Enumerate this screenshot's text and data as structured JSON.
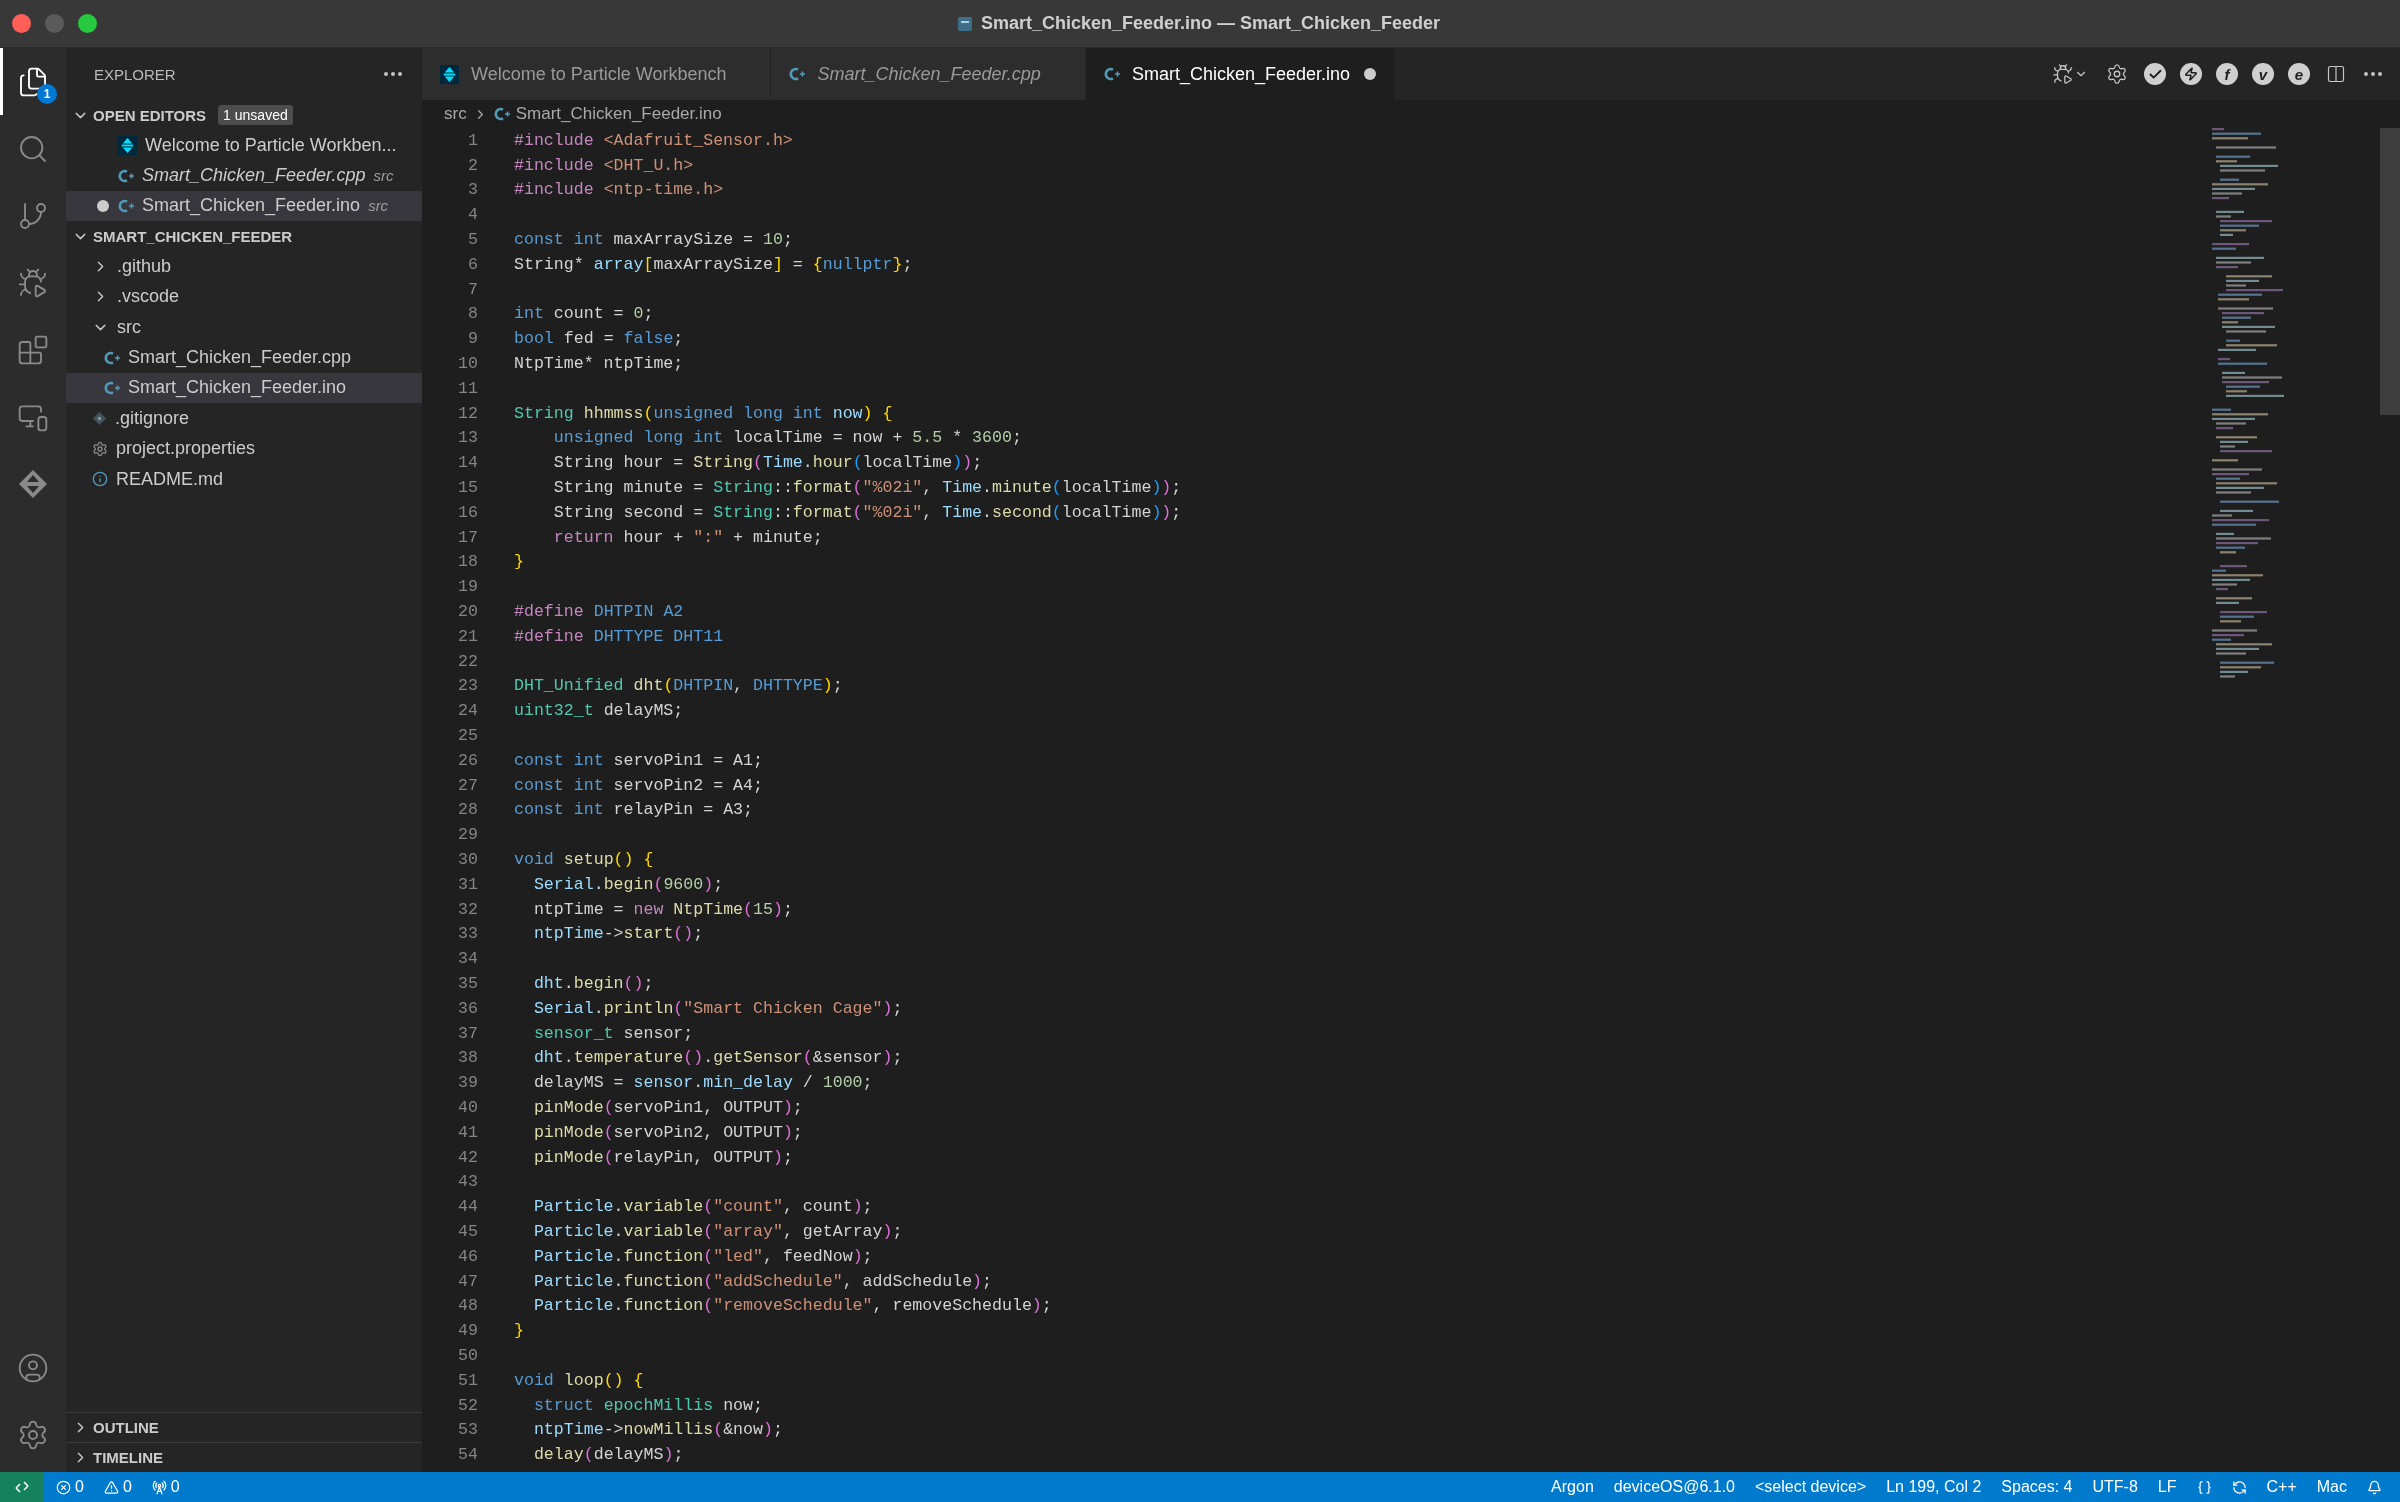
{
  "window": {
    "title": "Smart_Chicken_Feeder.ino — Smart_Chicken_Feeder"
  },
  "activity_bar": {
    "top": [
      {
        "kind": "files",
        "selected": true,
        "badge": "1"
      },
      {
        "kind": "search",
        "selected": false
      },
      {
        "kind": "source-control",
        "selected": false
      },
      {
        "kind": "run-debug",
        "selected": false
      },
      {
        "kind": "extensions",
        "selected": false
      },
      {
        "kind": "remote",
        "selected": false
      },
      {
        "kind": "particle",
        "selected": false
      }
    ],
    "bottom": [
      {
        "kind": "account"
      },
      {
        "kind": "settings"
      }
    ]
  },
  "sidebar": {
    "title": "EXPLORER",
    "open_editors": {
      "label": "OPEN EDITORS",
      "badge": "1 unsaved",
      "expanded": true,
      "items": [
        {
          "name": "Welcome to Particle Workben...",
          "kind": "particle",
          "preview": false,
          "dirty": false,
          "selected": false
        },
        {
          "name": "Smart_Chicken_Feeder.cpp",
          "description": "src",
          "kind": "cpp",
          "preview": true,
          "dirty": false,
          "selected": false
        },
        {
          "name": "Smart_Chicken_Feeder.ino",
          "description": "src",
          "kind": "cpp",
          "preview": false,
          "dirty": true,
          "selected": true
        }
      ]
    },
    "project": {
      "label": "SMART_CHICKEN_FEEDER",
      "expanded": true,
      "tree": [
        {
          "name": ".github",
          "kind": "folder",
          "expanded": false,
          "selected": false
        },
        {
          "name": ".vscode",
          "kind": "folder",
          "expanded": false,
          "selected": false
        },
        {
          "name": "src",
          "kind": "folder",
          "expanded": true,
          "selected": false,
          "children": [
            {
              "name": "Smart_Chicken_Feeder.cpp",
              "kind": "cpp",
              "selected": false
            },
            {
              "name": "Smart_Chicken_Feeder.ino",
              "kind": "cpp",
              "selected": true
            }
          ]
        },
        {
          "name": ".gitignore",
          "kind": "git",
          "selected": false
        },
        {
          "name": "project.properties",
          "kind": "gear",
          "selected": false
        },
        {
          "name": "README.md",
          "kind": "info",
          "selected": false
        }
      ]
    },
    "bottom_sections": [
      {
        "label": "OUTLINE",
        "expanded": false
      },
      {
        "label": "TIMELINE",
        "expanded": false
      }
    ]
  },
  "tabs": [
    {
      "label": "Welcome to Particle Workbench",
      "kind": "particle",
      "preview": false,
      "dirty": false,
      "selected": false
    },
    {
      "label": "Smart_Chicken_Feeder.cpp",
      "kind": "cpp",
      "preview": true,
      "dirty": false,
      "selected": false
    },
    {
      "label": "Smart_Chicken_Feeder.ino",
      "kind": "cpp",
      "preview": false,
      "dirty": true,
      "selected": true
    }
  ],
  "editor_actions": [
    {
      "kind": "run-debug"
    },
    {
      "kind": "gear"
    },
    {
      "kind": "check"
    },
    {
      "kind": "bolt"
    },
    {
      "kind": "letter",
      "text": "f"
    },
    {
      "kind": "letter",
      "text": "v"
    },
    {
      "kind": "letter",
      "text": "e"
    },
    {
      "kind": "split"
    },
    {
      "kind": "more"
    }
  ],
  "breadcrumb": [
    {
      "text": "src",
      "kind": "folder"
    },
    {
      "text": "Smart_Chicken_Feeder.ino",
      "kind": "cpp"
    }
  ],
  "code": {
    "lines": [
      {
        "n": "1",
        "tokens": [
          {
            "kind": "pp",
            "text": "#include "
          },
          {
            "kind": "str",
            "text": "<Adafruit_Sensor.h>"
          }
        ]
      },
      {
        "n": "2",
        "tokens": [
          {
            "kind": "pp",
            "text": "#include "
          },
          {
            "kind": "str",
            "text": "<DHT_U.h>"
          }
        ]
      },
      {
        "n": "3",
        "tokens": [
          {
            "kind": "pp",
            "text": "#include "
          },
          {
            "kind": "str",
            "text": "<ntp-time.h>"
          }
        ]
      },
      {
        "n": "4"
      },
      {
        "n": "5",
        "tokens": [
          {
            "kind": "kw",
            "text": "const int "
          },
          {
            "kind": "pl",
            "text": "maxArraySize = "
          },
          {
            "kind": "num",
            "text": "10"
          },
          {
            "kind": "pl",
            "text": ";"
          }
        ]
      },
      {
        "n": "6",
        "tokens": [
          {
            "kind": "pl",
            "text": "String* "
          },
          {
            "kind": "var",
            "text": "array"
          },
          {
            "kind": "br1",
            "text": "["
          },
          {
            "kind": "pl",
            "text": "maxArraySize"
          },
          {
            "kind": "br1",
            "text": "]"
          },
          {
            "kind": "pl",
            "text": " = "
          },
          {
            "kind": "br1",
            "text": "{"
          },
          {
            "kind": "kw",
            "text": "nullptr"
          },
          {
            "kind": "br1",
            "text": "}"
          },
          {
            "kind": "pl",
            "text": ";"
          }
        ]
      },
      {
        "n": "7"
      },
      {
        "n": "8",
        "tokens": [
          {
            "kind": "kw",
            "text": "int "
          },
          {
            "kind": "pl",
            "text": "count = "
          },
          {
            "kind": "num",
            "text": "0"
          },
          {
            "kind": "pl",
            "text": ";"
          }
        ]
      },
      {
        "n": "9",
        "tokens": [
          {
            "kind": "kw",
            "text": "bool "
          },
          {
            "kind": "pl",
            "text": "fed = "
          },
          {
            "kind": "kw",
            "text": "false"
          },
          {
            "kind": "pl",
            "text": ";"
          }
        ]
      },
      {
        "n": "10",
        "tokens": [
          {
            "kind": "pl",
            "text": "NtpTime* ntpTime;"
          }
        ]
      },
      {
        "n": "11"
      },
      {
        "n": "12",
        "tokens": [
          {
            "kind": "type",
            "text": "String "
          },
          {
            "kind": "fn",
            "text": "hhmmss"
          },
          {
            "kind": "br1",
            "text": "("
          },
          {
            "kind": "kw",
            "text": "unsigned long int "
          },
          {
            "kind": "var",
            "text": "now"
          },
          {
            "kind": "br1",
            "text": ")"
          },
          {
            "kind": "br1",
            "text": " {"
          }
        ]
      },
      {
        "n": "13",
        "tokens": [
          {
            "kind": "kw",
            "text": "    unsigned long int "
          },
          {
            "kind": "pl",
            "text": "localTime = now + "
          },
          {
            "kind": "num",
            "text": "5.5"
          },
          {
            "kind": "pl",
            "text": " * "
          },
          {
            "kind": "num",
            "text": "3600"
          },
          {
            "kind": "pl",
            "text": ";"
          }
        ]
      },
      {
        "n": "14",
        "tokens": [
          {
            "kind": "pl",
            "text": "    String hour = "
          },
          {
            "kind": "fn",
            "text": "String"
          },
          {
            "kind": "br2",
            "text": "("
          },
          {
            "kind": "var",
            "text": "Time"
          },
          {
            "kind": "pl",
            "text": "."
          },
          {
            "kind": "fn",
            "text": "hour"
          },
          {
            "kind": "br3",
            "text": "("
          },
          {
            "kind": "pl",
            "text": "localTime"
          },
          {
            "kind": "br3",
            "text": ")"
          },
          {
            "kind": "br2",
            "text": ")"
          },
          {
            "kind": "pl",
            "text": ";"
          }
        ]
      },
      {
        "n": "15",
        "tokens": [
          {
            "kind": "pl",
            "text": "    String minute = "
          },
          {
            "kind": "type",
            "text": "String"
          },
          {
            "kind": "pl",
            "text": "::"
          },
          {
            "kind": "fn",
            "text": "format"
          },
          {
            "kind": "br2",
            "text": "("
          },
          {
            "kind": "str",
            "text": "\"%02i\""
          },
          {
            "kind": "pl",
            "text": ", "
          },
          {
            "kind": "var",
            "text": "Time"
          },
          {
            "kind": "pl",
            "text": "."
          },
          {
            "kind": "fn",
            "text": "minute"
          },
          {
            "kind": "br3",
            "text": "("
          },
          {
            "kind": "pl",
            "text": "localTime"
          },
          {
            "kind": "br3",
            "text": ")"
          },
          {
            "kind": "br2",
            "text": ")"
          },
          {
            "kind": "pl",
            "text": ";"
          }
        ]
      },
      {
        "n": "16",
        "tokens": [
          {
            "kind": "pl",
            "text": "    String second = "
          },
          {
            "kind": "type",
            "text": "String"
          },
          {
            "kind": "pl",
            "text": "::"
          },
          {
            "kind": "fn",
            "text": "format"
          },
          {
            "kind": "br2",
            "text": "("
          },
          {
            "kind": "str",
            "text": "\"%02i\""
          },
          {
            "kind": "pl",
            "text": ", "
          },
          {
            "kind": "var",
            "text": "Time"
          },
          {
            "kind": "pl",
            "text": "."
          },
          {
            "kind": "fn",
            "text": "second"
          },
          {
            "kind": "br3",
            "text": "("
          },
          {
            "kind": "pl",
            "text": "localTime"
          },
          {
            "kind": "br3",
            "text": ")"
          },
          {
            "kind": "br2",
            "text": ")"
          },
          {
            "kind": "pl",
            "text": ";"
          }
        ]
      },
      {
        "n": "17",
        "tokens": [
          {
            "kind": "ctl",
            "text": "    return"
          },
          {
            "kind": "pl",
            "text": " hour + "
          },
          {
            "kind": "str",
            "text": "\":\""
          },
          {
            "kind": "pl",
            "text": " + minute;"
          }
        ]
      },
      {
        "n": "18",
        "tokens": [
          {
            "kind": "br1",
            "text": "}"
          }
        ]
      },
      {
        "n": "19"
      },
      {
        "n": "20",
        "tokens": [
          {
            "kind": "pp",
            "text": "#define "
          },
          {
            "kind": "kw",
            "text": "DHTPIN A2"
          }
        ]
      },
      {
        "n": "21",
        "tokens": [
          {
            "kind": "pp",
            "text": "#define "
          },
          {
            "kind": "kw",
            "text": "DHTTYPE DHT11"
          }
        ]
      },
      {
        "n": "22"
      },
      {
        "n": "23",
        "tokens": [
          {
            "kind": "type",
            "text": "DHT_Unified "
          },
          {
            "kind": "fn",
            "text": "dht"
          },
          {
            "kind": "br1",
            "text": "("
          },
          {
            "kind": "kw",
            "text": "DHTPIN"
          },
          {
            "kind": "pl",
            "text": ", "
          },
          {
            "kind": "kw",
            "text": "DHTTYPE"
          },
          {
            "kind": "br1",
            "text": ")"
          },
          {
            "kind": "pl",
            "text": ";"
          }
        ]
      },
      {
        "n": "24",
        "tokens": [
          {
            "kind": "type",
            "text": "uint32_t "
          },
          {
            "kind": "pl",
            "text": "delayMS;"
          }
        ]
      },
      {
        "n": "25"
      },
      {
        "n": "26",
        "tokens": [
          {
            "kind": "kw",
            "text": "const int "
          },
          {
            "kind": "pl",
            "text": "servoPin1 = A1;"
          }
        ]
      },
      {
        "n": "27",
        "tokens": [
          {
            "kind": "kw",
            "text": "const int "
          },
          {
            "kind": "pl",
            "text": "servoPin2 = A4;"
          }
        ]
      },
      {
        "n": "28",
        "tokens": [
          {
            "kind": "kw",
            "text": "const int "
          },
          {
            "kind": "pl",
            "text": "relayPin = A3;"
          }
        ]
      },
      {
        "n": "29"
      },
      {
        "n": "30",
        "tokens": [
          {
            "kind": "kw",
            "text": "void "
          },
          {
            "kind": "fn",
            "text": "setup"
          },
          {
            "kind": "br1",
            "text": "()"
          },
          {
            "kind": "br1",
            "text": " {"
          }
        ]
      },
      {
        "n": "31",
        "tokens": [
          {
            "kind": "var",
            "text": "  Serial"
          },
          {
            "kind": "pl",
            "text": "."
          },
          {
            "kind": "fn",
            "text": "begin"
          },
          {
            "kind": "br2",
            "text": "("
          },
          {
            "kind": "num",
            "text": "9600"
          },
          {
            "kind": "br2",
            "text": ")"
          },
          {
            "kind": "pl",
            "text": ";"
          }
        ]
      },
      {
        "n": "32",
        "tokens": [
          {
            "kind": "pl",
            "text": "  ntpTime = "
          },
          {
            "kind": "ctl",
            "text": "new "
          },
          {
            "kind": "fn",
            "text": "NtpTime"
          },
          {
            "kind": "br2",
            "text": "("
          },
          {
            "kind": "num",
            "text": "15"
          },
          {
            "kind": "br2",
            "text": ")"
          },
          {
            "kind": "pl",
            "text": ";"
          }
        ]
      },
      {
        "n": "33",
        "tokens": [
          {
            "kind": "var",
            "text": "  ntpTime"
          },
          {
            "kind": "pl",
            "text": "->"
          },
          {
            "kind": "fn",
            "text": "start"
          },
          {
            "kind": "br2",
            "text": "()"
          },
          {
            "kind": "pl",
            "text": ";"
          }
        ]
      },
      {
        "n": "34"
      },
      {
        "n": "35",
        "tokens": [
          {
            "kind": "var",
            "text": "  dht"
          },
          {
            "kind": "pl",
            "text": "."
          },
          {
            "kind": "fn",
            "text": "begin"
          },
          {
            "kind": "br2",
            "text": "()"
          },
          {
            "kind": "pl",
            "text": ";"
          }
        ]
      },
      {
        "n": "36",
        "tokens": [
          {
            "kind": "var",
            "text": "  Serial"
          },
          {
            "kind": "pl",
            "text": "."
          },
          {
            "kind": "fn",
            "text": "println"
          },
          {
            "kind": "br2",
            "text": "("
          },
          {
            "kind": "str",
            "text": "\"Smart Chicken Cage\""
          },
          {
            "kind": "br2",
            "text": ")"
          },
          {
            "kind": "pl",
            "text": ";"
          }
        ]
      },
      {
        "n": "37",
        "tokens": [
          {
            "kind": "type",
            "text": "  sensor_t"
          },
          {
            "kind": "pl",
            "text": " sensor;"
          }
        ]
      },
      {
        "n": "38",
        "tokens": [
          {
            "kind": "var",
            "text": "  dht"
          },
          {
            "kind": "pl",
            "text": "."
          },
          {
            "kind": "fn",
            "text": "temperature"
          },
          {
            "kind": "br2",
            "text": "()"
          },
          {
            "kind": "pl",
            "text": "."
          },
          {
            "kind": "fn",
            "text": "getSensor"
          },
          {
            "kind": "br2",
            "text": "("
          },
          {
            "kind": "pl",
            "text": "&sensor"
          },
          {
            "kind": "br2",
            "text": ")"
          },
          {
            "kind": "pl",
            "text": ";"
          }
        ]
      },
      {
        "n": "39",
        "tokens": [
          {
            "kind": "pl",
            "text": "  delayMS = "
          },
          {
            "kind": "var",
            "text": "sensor"
          },
          {
            "kind": "pl",
            "text": "."
          },
          {
            "kind": "var",
            "text": "min_delay"
          },
          {
            "kind": "pl",
            "text": " / "
          },
          {
            "kind": "num",
            "text": "1000"
          },
          {
            "kind": "pl",
            "text": ";"
          }
        ]
      },
      {
        "n": "40",
        "tokens": [
          {
            "kind": "fn",
            "text": "  pinMode"
          },
          {
            "kind": "br2",
            "text": "("
          },
          {
            "kind": "pl",
            "text": "servoPin1, OUTPUT"
          },
          {
            "kind": "br2",
            "text": ")"
          },
          {
            "kind": "pl",
            "text": ";"
          }
        ]
      },
      {
        "n": "41",
        "tokens": [
          {
            "kind": "fn",
            "text": "  pinMode"
          },
          {
            "kind": "br2",
            "text": "("
          },
          {
            "kind": "pl",
            "text": "servoPin2, OUTPUT"
          },
          {
            "kind": "br2",
            "text": ")"
          },
          {
            "kind": "pl",
            "text": ";"
          }
        ]
      },
      {
        "n": "42",
        "tokens": [
          {
            "kind": "fn",
            "text": "  pinMode"
          },
          {
            "kind": "br2",
            "text": "("
          },
          {
            "kind": "pl",
            "text": "relayPin, OUTPUT"
          },
          {
            "kind": "br2",
            "text": ")"
          },
          {
            "kind": "pl",
            "text": ";"
          }
        ]
      },
      {
        "n": "43"
      },
      {
        "n": "44",
        "tokens": [
          {
            "kind": "var",
            "text": "  Particle"
          },
          {
            "kind": "pl",
            "text": "."
          },
          {
            "kind": "fn",
            "text": "variable"
          },
          {
            "kind": "br2",
            "text": "("
          },
          {
            "kind": "str",
            "text": "\"count\""
          },
          {
            "kind": "pl",
            "text": ", count"
          },
          {
            "kind": "br2",
            "text": ")"
          },
          {
            "kind": "pl",
            "text": ";"
          }
        ]
      },
      {
        "n": "45",
        "tokens": [
          {
            "kind": "var",
            "text": "  Particle"
          },
          {
            "kind": "pl",
            "text": "."
          },
          {
            "kind": "fn",
            "text": "variable"
          },
          {
            "kind": "br2",
            "text": "("
          },
          {
            "kind": "str",
            "text": "\"array\""
          },
          {
            "kind": "pl",
            "text": ", getArray"
          },
          {
            "kind": "br2",
            "text": ")"
          },
          {
            "kind": "pl",
            "text": ";"
          }
        ]
      },
      {
        "n": "46",
        "tokens": [
          {
            "kind": "var",
            "text": "  Particle"
          },
          {
            "kind": "pl",
            "text": "."
          },
          {
            "kind": "fn",
            "text": "function"
          },
          {
            "kind": "br2",
            "text": "("
          },
          {
            "kind": "str",
            "text": "\"led\""
          },
          {
            "kind": "pl",
            "text": ", feedNow"
          },
          {
            "kind": "br2",
            "text": ")"
          },
          {
            "kind": "pl",
            "text": ";"
          }
        ]
      },
      {
        "n": "47",
        "tokens": [
          {
            "kind": "var",
            "text": "  Particle"
          },
          {
            "kind": "pl",
            "text": "."
          },
          {
            "kind": "fn",
            "text": "function"
          },
          {
            "kind": "br2",
            "text": "("
          },
          {
            "kind": "str",
            "text": "\"addSchedule\""
          },
          {
            "kind": "pl",
            "text": ", addSchedule"
          },
          {
            "kind": "br2",
            "text": ")"
          },
          {
            "kind": "pl",
            "text": ";"
          }
        ]
      },
      {
        "n": "48",
        "tokens": [
          {
            "kind": "var",
            "text": "  Particle"
          },
          {
            "kind": "pl",
            "text": "."
          },
          {
            "kind": "fn",
            "text": "function"
          },
          {
            "kind": "br2",
            "text": "("
          },
          {
            "kind": "str",
            "text": "\"removeSchedule\""
          },
          {
            "kind": "pl",
            "text": ", removeSchedule"
          },
          {
            "kind": "br2",
            "text": ")"
          },
          {
            "kind": "pl",
            "text": ";"
          }
        ]
      },
      {
        "n": "49",
        "tokens": [
          {
            "kind": "br1",
            "text": "}"
          }
        ]
      },
      {
        "n": "50"
      },
      {
        "n": "51",
        "tokens": [
          {
            "kind": "kw",
            "text": "void "
          },
          {
            "kind": "fn",
            "text": "loop"
          },
          {
            "kind": "br1",
            "text": "()"
          },
          {
            "kind": "br1",
            "text": " {"
          }
        ]
      },
      {
        "n": "52",
        "tokens": [
          {
            "kind": "kw",
            "text": "  struct "
          },
          {
            "kind": "type",
            "text": "epochMillis"
          },
          {
            "kind": "pl",
            "text": " now;"
          }
        ]
      },
      {
        "n": "53",
        "tokens": [
          {
            "kind": "var",
            "text": "  ntpTime"
          },
          {
            "kind": "pl",
            "text": "->"
          },
          {
            "kind": "fn",
            "text": "nowMillis"
          },
          {
            "kind": "br2",
            "text": "("
          },
          {
            "kind": "pl",
            "text": "&now"
          },
          {
            "kind": "br2",
            "text": ")"
          },
          {
            "kind": "pl",
            "text": ";"
          }
        ]
      },
      {
        "n": "54",
        "tokens": [
          {
            "kind": "fn",
            "text": "  delay"
          },
          {
            "kind": "br2",
            "text": "("
          },
          {
            "kind": "pl",
            "text": "delayMS"
          },
          {
            "kind": "br2",
            "text": ")"
          },
          {
            "kind": "pl",
            "text": ";"
          }
        ]
      }
    ]
  },
  "status_bar": {
    "left": [
      {
        "kind": "remote"
      },
      {
        "kind": "errors",
        "text": "0"
      },
      {
        "kind": "warnings",
        "text": "0"
      },
      {
        "kind": "ports",
        "text": "0"
      }
    ],
    "right": [
      {
        "kind": "text",
        "text": "Argon"
      },
      {
        "kind": "text",
        "text": "deviceOS@6.1.0"
      },
      {
        "kind": "text",
        "text": "<select device>"
      },
      {
        "kind": "text",
        "text": "Ln 199, Col 2"
      },
      {
        "kind": "text",
        "text": "Spaces: 4"
      },
      {
        "kind": "text",
        "text": "UTF-8"
      },
      {
        "kind": "text",
        "text": "LF"
      },
      {
        "kind": "braces"
      },
      {
        "kind": "sync"
      },
      {
        "kind": "text",
        "text": "C++"
      },
      {
        "kind": "text",
        "text": "Mac"
      },
      {
        "kind": "bell"
      }
    ]
  }
}
